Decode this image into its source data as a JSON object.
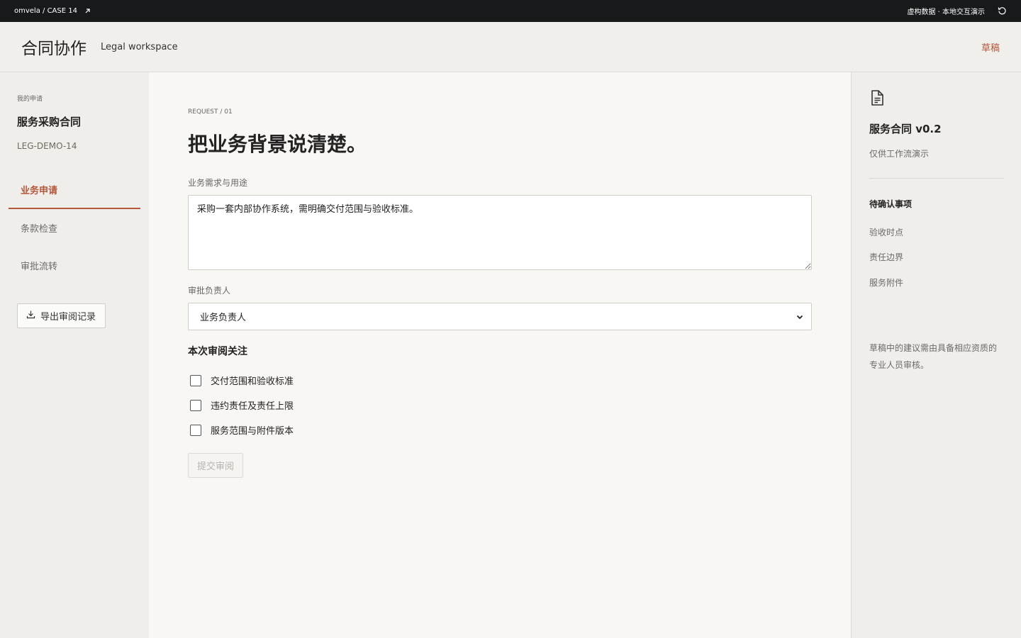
{
  "topbar": {
    "breadcrumb": "omvela / CASE 14",
    "demo_note": "虚构数据 · 本地交互演示"
  },
  "header": {
    "title": "合同协作",
    "subtitle": "Legal workspace",
    "status": "草稿"
  },
  "sidebar": {
    "eyebrow": "我的申请",
    "contract_name": "服务采购合同",
    "contract_id": "LEG-DEMO-14",
    "nav": [
      {
        "label": "业务申请",
        "active": true
      },
      {
        "label": "条款检查",
        "active": false
      },
      {
        "label": "审批流转",
        "active": false
      }
    ],
    "export_label": "导出审阅记录"
  },
  "main": {
    "step": "REQUEST / 01",
    "heading": "把业务背景说清楚。",
    "purpose_label": "业务需求与用途",
    "purpose_value": "采购一套内部协作系统，需明确交付范围与验收标准。",
    "approver_label": "审批负责人",
    "approver_value": "业务负责人",
    "focus_title": "本次审阅关注",
    "focus_items": [
      {
        "label": "交付范围和验收标准",
        "checked": false
      },
      {
        "label": "违约责任及责任上限",
        "checked": false
      },
      {
        "label": "服务范围与附件版本",
        "checked": false
      }
    ],
    "submit_label": "提交审阅"
  },
  "aside": {
    "doc_title": "服务合同 v0.2",
    "doc_sub": "仅供工作流演示",
    "pending_title": "待确认事项",
    "pending_items": [
      "验收时点",
      "责任边界",
      "服务附件"
    ],
    "note": "草稿中的建议需由具备相应资质的专业人员审核。"
  },
  "colors": {
    "accent": "#b5573a",
    "topbar_bg": "#171a1b",
    "panel_bg": "#efeeea",
    "main_bg": "#f8f7f3"
  }
}
